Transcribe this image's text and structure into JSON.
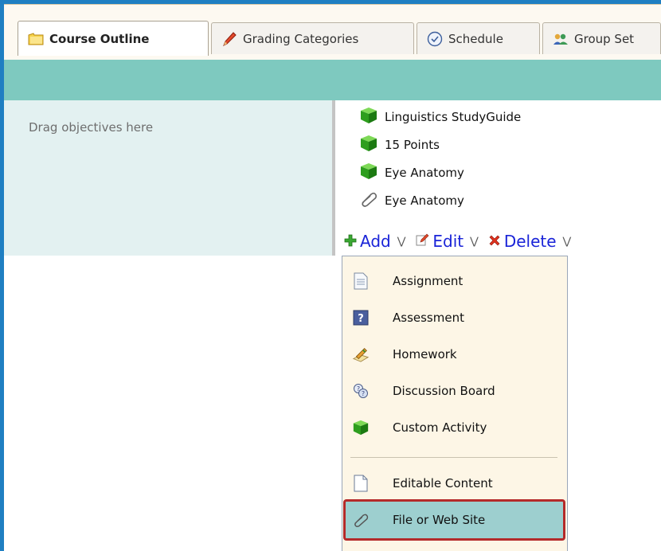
{
  "tabs": [
    {
      "label": "Course Outline",
      "icon": "folder-icon",
      "active": true
    },
    {
      "label": "Grading Categories",
      "icon": "pencil-icon",
      "active": false
    },
    {
      "label": "Schedule",
      "icon": "clock-icon",
      "active": false
    },
    {
      "label": "Group Set",
      "icon": "group-icon",
      "active": false
    }
  ],
  "left_panel": {
    "drop_text": "Drag objectives here"
  },
  "objectives": [
    {
      "label": "Linguistics StudyGuide",
      "icon": "green-cube-icon"
    },
    {
      "label": "15 Points",
      "icon": "green-cube-icon"
    },
    {
      "label": "Eye Anatomy",
      "icon": "green-cube-icon"
    },
    {
      "label": "Eye Anatomy",
      "icon": "paperclip-icon"
    }
  ],
  "actions": {
    "add": "Add",
    "edit": "Edit",
    "delete": "Delete"
  },
  "menu": {
    "items": [
      {
        "label": "Assignment",
        "icon": "document-icon"
      },
      {
        "label": "Assessment",
        "icon": "question-icon"
      },
      {
        "label": "Homework",
        "icon": "homework-icon"
      },
      {
        "label": "Discussion Board",
        "icon": "discussion-icon"
      },
      {
        "label": "Custom Activity",
        "icon": "green-cube-icon"
      },
      {
        "label": "Editable Content",
        "icon": "blank-page-icon"
      },
      {
        "label": "File or Web Site",
        "icon": "paperclip-icon",
        "selected": true
      }
    ]
  },
  "colors": {
    "frame": "#1f7fc2",
    "teal_bar": "#7ec9bf",
    "left_panel": "#e3f1f1",
    "link": "#1a24d8",
    "menu_bg": "#fdf6e6",
    "selected_bg": "#9dcfcf",
    "highlight_border": "#b42a2a"
  }
}
